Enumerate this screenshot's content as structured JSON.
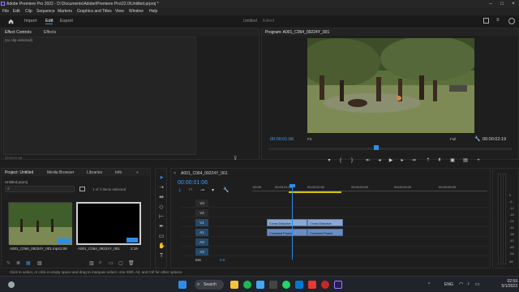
{
  "app": {
    "title": "Adobe Premiere Pro 2022 - D:\\Documents\\Adobe\\Premiere Pro\\22.0\\Untitled.prproj *",
    "project_name": "Untitled",
    "project_state": "Edited"
  },
  "menu": [
    "File",
    "Edit",
    "Clip",
    "Sequence",
    "Markers",
    "Graphics and Titles",
    "View",
    "Window",
    "Help"
  ],
  "workspace_tabs": [
    "Import",
    "Edit",
    "Export"
  ],
  "effect_panel": {
    "tabs": [
      "Effect Controls",
      "Effects"
    ],
    "no_clip": "(no clip selected)",
    "timecode": "00:00:01:06"
  },
  "program": {
    "title": "Program: A001_C064_09224Y_001",
    "timecode_current": "00:00:01:06",
    "timecode_duration": "00:00:02:19",
    "zoom": "Fit",
    "quality": "Full"
  },
  "project_panel": {
    "tabs": [
      "Project: Untitled",
      "Media Browser",
      "Libraries",
      "Info"
    ],
    "file": "Untitled.prproj",
    "selection_count": "1 of 2 items selected",
    "items": [
      {
        "name": "A001_C064_09224Y_001.mp4",
        "duration": "2:08"
      },
      {
        "name": "A001_C064_09224Y_001",
        "duration": "2:19"
      }
    ]
  },
  "timeline": {
    "sequence_tab": "A001_C064_09224Y_001",
    "timecode": "00:00:01:06",
    "ruler_ticks": [
      ":00:00",
      "00:00:01:00",
      "00:00:02:00",
      "00:00:03:00",
      "00:00:04:00",
      "00:00:05:00"
    ],
    "tracks": [
      "V3",
      "V2",
      "V1",
      "A1",
      "A2",
      "A3"
    ],
    "mix_label": "Mix",
    "mix_value": "0.0",
    "clips": {
      "v1_left": "Cross Dissolve",
      "v1_right": "Cross Dissolve",
      "a1_left": "Constant Power",
      "a1_right": "Constant Power"
    }
  },
  "meter": {
    "db": [
      "0",
      "-6",
      "-12",
      "-18",
      "-24",
      "-30",
      "-36",
      "-42",
      "-48",
      "-54"
    ],
    "unit": "dB"
  },
  "status": {
    "hint": "Click to select, or click in empty space and drag to marquee select. Use Shift, Alt, and Ctrl for other options."
  },
  "taskbar": {
    "search": "Search",
    "lang": "ENG",
    "time": "02:59",
    "date": "5/1/2023"
  },
  "colors": {
    "accent": "#2d8ceb",
    "inout": "#d4c300",
    "premiere": "#9b7dff"
  }
}
